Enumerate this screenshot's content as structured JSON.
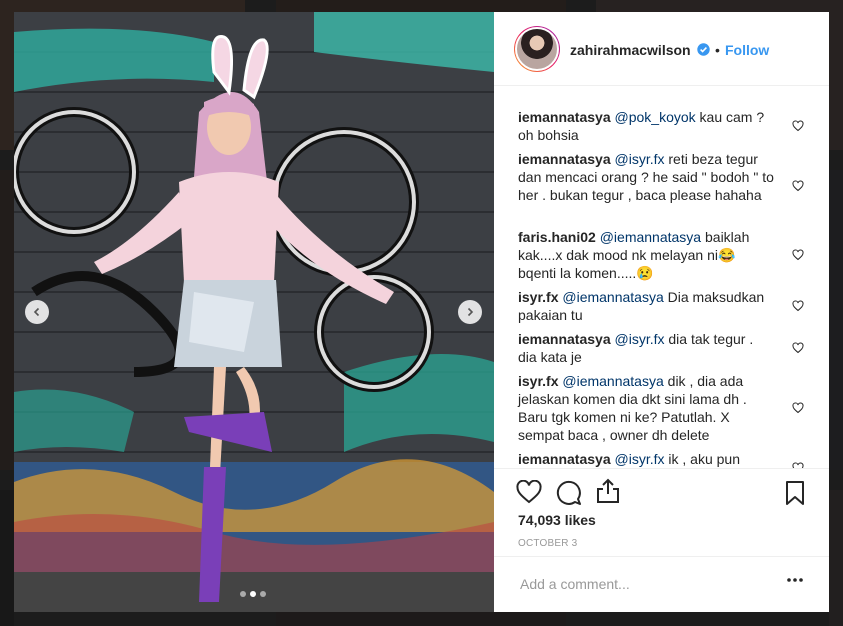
{
  "post": {
    "username": "zahirahmacwilson",
    "verified": true,
    "separator": "•",
    "follow_label": "Follow",
    "likes": "74,093 likes",
    "date": "OCTOBER 3",
    "add_comment_placeholder": "Add a comment...",
    "carousel": {
      "total": 3,
      "active": 2
    }
  },
  "comments": [
    {
      "user": "iemannatasya",
      "mention": "@pok_koyok",
      "text": " kau cam ? oh bohsia"
    },
    {
      "user": "iemannatasya",
      "mention": "@isyr.fx",
      "text": " reti beza tegur dan mencaci orang ? he said \" bodoh \" to her . bukan tegur , baca please hahaha"
    },
    {
      "user": "faris.hani02",
      "mention": "@iemannatasya",
      "text": " baiklah kak....x dak mood nk melayan ni😂 bqenti la komen.....😢"
    },
    {
      "user": "isyr.fx",
      "mention": "@iemannatasya",
      "text": " Dia maksudkan pakaian tu"
    },
    {
      "user": "iemannatasya",
      "mention": "@isyr.fx",
      "text": " dia tak tegur . dia kata je"
    },
    {
      "user": "isyr.fx",
      "mention": "@iemannatasya",
      "text": " dik , dia ada jelaskan komen dia dkt sini lama dh . Baru tgk komen ni ke? Patutlah. X sempat baca , owner dh delete"
    },
    {
      "user": "iemannatasya",
      "mention": "@isyr.fx",
      "text": " ik , aku pun cakap je , jangan beria wak"
    }
  ],
  "colors": {
    "accent": "#3897f0",
    "text": "#262626",
    "muted": "#999999"
  },
  "icons": {
    "like": "heart-icon",
    "comment": "comment-bubble-icon",
    "share": "share-icon",
    "save": "bookmark-icon",
    "more": "more-dots-icon",
    "prev": "chevron-left-icon",
    "next": "chevron-right-icon"
  }
}
